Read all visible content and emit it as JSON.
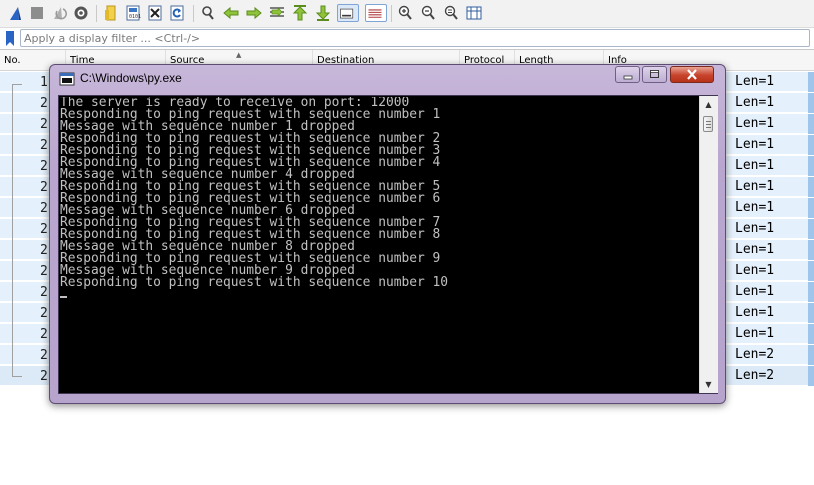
{
  "toolbar": {
    "icons": [
      "shark-fin-start-icon",
      "stop-square-icon",
      "restart-icon",
      "options-gear-icon",
      "open-folder-icon",
      "save-file-icon",
      "close-file-icon",
      "reload-file-icon",
      "find-magnifier-icon",
      "back-arrow-icon",
      "forward-arrow-icon",
      "jump-to-packet-icon",
      "first-packet-arrow-icon",
      "last-packet-arrow-icon",
      "auto-scroll-icon",
      "colorize-icon",
      "zoom-in-icon",
      "zoom-out-icon",
      "normal-size-icon",
      "resize-columns-icon"
    ]
  },
  "filter": {
    "placeholder": "Apply a display filter ... <Ctrl-/>"
  },
  "packet_list": {
    "columns": [
      "No.",
      "Time",
      "Source",
      "Destination",
      "Protocol",
      "Length",
      "Info"
    ],
    "rows": [
      {
        "no": "1",
        "len": "Len=1"
      },
      {
        "no": "2",
        "len": "Len=1"
      },
      {
        "no": "2",
        "len": "Len=1"
      },
      {
        "no": "2",
        "len": "Len=1"
      },
      {
        "no": "2",
        "len": "Len=1"
      },
      {
        "no": "2",
        "len": "Len=1"
      },
      {
        "no": "2",
        "len": "Len=1"
      },
      {
        "no": "2",
        "len": "Len=1"
      },
      {
        "no": "2",
        "len": "Len=1"
      },
      {
        "no": "2",
        "len": "Len=1"
      },
      {
        "no": "2",
        "len": "Len=1"
      },
      {
        "no": "2",
        "len": "Len=1"
      },
      {
        "no": "2",
        "len": "Len=1"
      },
      {
        "no": "2",
        "len": "Len=2"
      },
      {
        "no": "2",
        "len": "Len=2"
      }
    ]
  },
  "console": {
    "title": "C:\\Windows\\py.exe",
    "lines": [
      "The server is ready to receive on port: 12000",
      "Responding to ping request with sequence number 1",
      "Message with sequence number 1 dropped",
      "Responding to ping request with sequence number 2",
      "Responding to ping request with sequence number 3",
      "Responding to ping request with sequence number 4",
      "Message with sequence number 4 dropped",
      "Responding to ping request with sequence number 5",
      "Responding to ping request with sequence number 6",
      "Message with sequence number 6 dropped",
      "Responding to ping request with sequence number 7",
      "Responding to ping request with sequence number 8",
      "Message with sequence number 8 dropped",
      "Responding to ping request with sequence number 9",
      "Message with sequence number 9 dropped",
      "Responding to ping request with sequence number 10"
    ]
  },
  "colors": {
    "selected_row": "#e4f0fb",
    "console_bg": "#000000",
    "console_fg": "#c0c0c0",
    "window_frame": "#b9a6cf",
    "close_button": "#c7432c"
  }
}
